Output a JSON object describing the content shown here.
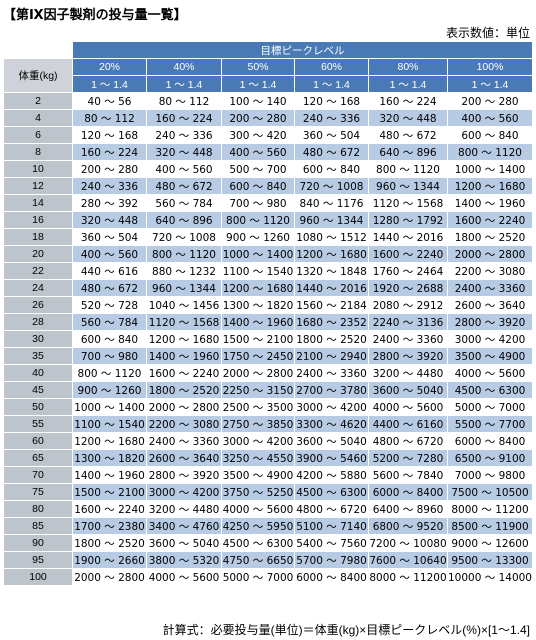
{
  "title": "【第Ⅸ因子製剤の投与量一覧】",
  "unit_note": "表示数値：単位",
  "header": {
    "group_label": "目標ピークレベル",
    "weight_label": "体重(kg)",
    "levels": [
      "20%",
      "40%",
      "50%",
      "60%",
      "80%",
      "100%"
    ],
    "range_label": "1 ～ 1.4"
  },
  "rows": [
    {
      "w": "2",
      "c": [
        "40 ～ 56",
        "80 ～ 112",
        "100 ～ 140",
        "120 ～ 168",
        "160 ～ 224",
        "200 ～ 280"
      ]
    },
    {
      "w": "4",
      "c": [
        "80 ～ 112",
        "160 ～ 224",
        "200 ～ 280",
        "240 ～ 336",
        "320 ～ 448",
        "400 ～ 560"
      ]
    },
    {
      "w": "6",
      "c": [
        "120 ～ 168",
        "240 ～ 336",
        "300 ～ 420",
        "360 ～ 504",
        "480 ～ 672",
        "600 ～ 840"
      ]
    },
    {
      "w": "8",
      "c": [
        "160 ～ 224",
        "320 ～ 448",
        "400 ～ 560",
        "480 ～ 672",
        "640 ～ 896",
        "800 ～ 1120"
      ]
    },
    {
      "w": "10",
      "c": [
        "200 ～ 280",
        "400 ～ 560",
        "500 ～ 700",
        "600 ～ 840",
        "800 ～ 1120",
        "1000 ～ 1400"
      ]
    },
    {
      "w": "12",
      "c": [
        "240 ～ 336",
        "480 ～ 672",
        "600 ～ 840",
        "720 ～ 1008",
        "960 ～ 1344",
        "1200 ～ 1680"
      ]
    },
    {
      "w": "14",
      "c": [
        "280 ～ 392",
        "560 ～ 784",
        "700 ～ 980",
        "840 ～ 1176",
        "1120 ～ 1568",
        "1400 ～ 1960"
      ]
    },
    {
      "w": "16",
      "c": [
        "320 ～ 448",
        "640 ～ 896",
        "800 ～ 1120",
        "960 ～ 1344",
        "1280 ～ 1792",
        "1600 ～ 2240"
      ]
    },
    {
      "w": "18",
      "c": [
        "360 ～ 504",
        "720 ～ 1008",
        "900 ～ 1260",
        "1080 ～ 1512",
        "1440 ～ 2016",
        "1800 ～ 2520"
      ]
    },
    {
      "w": "20",
      "c": [
        "400 ～ 560",
        "800 ～ 1120",
        "1000 ～ 1400",
        "1200 ～ 1680",
        "1600 ～ 2240",
        "2000 ～ 2800"
      ]
    },
    {
      "w": "22",
      "c": [
        "440 ～ 616",
        "880 ～ 1232",
        "1100 ～ 1540",
        "1320 ～ 1848",
        "1760 ～ 2464",
        "2200 ～ 3080"
      ]
    },
    {
      "w": "24",
      "c": [
        "480 ～ 672",
        "960 ～ 1344",
        "1200 ～ 1680",
        "1440 ～ 2016",
        "1920 ～ 2688",
        "2400 ～ 3360"
      ]
    },
    {
      "w": "26",
      "c": [
        "520 ～ 728",
        "1040 ～ 1456",
        "1300 ～ 1820",
        "1560 ～ 2184",
        "2080 ～ 2912",
        "2600 ～ 3640"
      ]
    },
    {
      "w": "28",
      "c": [
        "560 ～ 784",
        "1120 ～ 1568",
        "1400 ～ 1960",
        "1680 ～ 2352",
        "2240 ～ 3136",
        "2800 ～ 3920"
      ]
    },
    {
      "w": "30",
      "c": [
        "600 ～ 840",
        "1200 ～ 1680",
        "1500 ～ 2100",
        "1800 ～ 2520",
        "2400 ～ 3360",
        "3000 ～ 4200"
      ]
    },
    {
      "w": "35",
      "c": [
        "700 ～ 980",
        "1400 ～ 1960",
        "1750 ～ 2450",
        "2100 ～ 2940",
        "2800 ～ 3920",
        "3500 ～ 4900"
      ]
    },
    {
      "w": "40",
      "c": [
        "800 ～ 1120",
        "1600 ～ 2240",
        "2000 ～ 2800",
        "2400 ～ 3360",
        "3200 ～ 4480",
        "4000 ～ 5600"
      ]
    },
    {
      "w": "45",
      "c": [
        "900 ～ 1260",
        "1800 ～ 2520",
        "2250 ～ 3150",
        "2700 ～ 3780",
        "3600 ～ 5040",
        "4500 ～ 6300"
      ]
    },
    {
      "w": "50",
      "c": [
        "1000 ～ 1400",
        "2000 ～ 2800",
        "2500 ～ 3500",
        "3000 ～ 4200",
        "4000 ～ 5600",
        "5000 ～ 7000"
      ]
    },
    {
      "w": "55",
      "c": [
        "1100 ～ 1540",
        "2200 ～ 3080",
        "2750 ～ 3850",
        "3300 ～ 4620",
        "4400 ～ 6160",
        "5500 ～ 7700"
      ]
    },
    {
      "w": "60",
      "c": [
        "1200 ～ 1680",
        "2400 ～ 3360",
        "3000 ～ 4200",
        "3600 ～ 5040",
        "4800 ～ 6720",
        "6000 ～ 8400"
      ]
    },
    {
      "w": "65",
      "c": [
        "1300 ～ 1820",
        "2600 ～ 3640",
        "3250 ～ 4550",
        "3900 ～ 5460",
        "5200 ～ 7280",
        "6500 ～ 9100"
      ]
    },
    {
      "w": "70",
      "c": [
        "1400 ～ 1960",
        "2800 ～ 3920",
        "3500 ～ 4900",
        "4200 ～ 5880",
        "5600 ～ 7840",
        "7000 ～ 9800"
      ]
    },
    {
      "w": "75",
      "c": [
        "1500 ～ 2100",
        "3000 ～ 4200",
        "3750 ～ 5250",
        "4500 ～ 6300",
        "6000 ～ 8400",
        "7500 ～ 10500"
      ]
    },
    {
      "w": "80",
      "c": [
        "1600 ～ 2240",
        "3200 ～ 4480",
        "4000 ～ 5600",
        "4800 ～ 6720",
        "6400 ～ 8960",
        "8000 ～ 11200"
      ]
    },
    {
      "w": "85",
      "c": [
        "1700 ～ 2380",
        "3400 ～ 4760",
        "4250 ～ 5950",
        "5100 ～ 7140",
        "6800 ～ 9520",
        "8500 ～ 11900"
      ]
    },
    {
      "w": "90",
      "c": [
        "1800 ～ 2520",
        "3600 ～ 5040",
        "4500 ～ 6300",
        "5400 ～ 7560",
        "7200 ～ 10080",
        "9000 ～ 12600"
      ]
    },
    {
      "w": "95",
      "c": [
        "1900 ～ 2660",
        "3800 ～ 5320",
        "4750 ～ 6650",
        "5700 ～ 7980",
        "7600 ～ 10640",
        "9500 ～ 13300"
      ]
    },
    {
      "w": "100",
      "c": [
        "2000 ～ 2800",
        "4000 ～ 5600",
        "5000 ～ 7000",
        "6000 ～ 8400",
        "8000 ～ 11200",
        "10000 ～ 14000"
      ]
    }
  ],
  "formula": "計算式：必要投与量(単位)＝体重(kg)×目標ピークレベル(%)×[1～1.4]",
  "colors": {
    "header_blue": "#4a7ab6",
    "row_blue": "#b8cbe4",
    "weight_gray": "#bec4cc"
  }
}
